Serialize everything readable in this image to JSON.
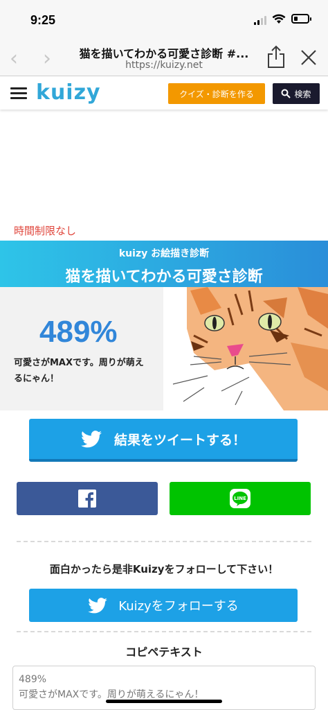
{
  "status_bar": {
    "time": "9:25",
    "battery_level": 0.25
  },
  "browser": {
    "back_icon": "chevron-left-icon",
    "forward_icon": "chevron-right-icon",
    "page_title": "猫を描いてわかる可愛さ診断 #...",
    "url": "https://kuizy.net",
    "share_icon": "share-icon",
    "close_icon": "close-icon"
  },
  "header": {
    "logo": "kuizy",
    "create_label": "クイズ・診断を作る",
    "search_label": "検索",
    "colors": {
      "logo": "#31a7d8",
      "create": "#f39800",
      "search": "#1a1a2e"
    }
  },
  "main": {
    "time_limit": "時間制限なし",
    "banner": {
      "subtitle": "kuizy お絵描き診断",
      "title": "猫を描いてわかる可愛さ診断"
    },
    "result": {
      "percent": "489%",
      "text": "可愛さがMAXです。周りが萌えるにゃん！"
    },
    "tweet_label": "結果をツイートする！",
    "facebook_icon": "facebook-icon",
    "line_icon": "line-icon",
    "follow_heading": "面白かったら是非Kuizyをフォローして下さい！",
    "follow_label": "Kuizyをフォローする",
    "copy_heading": "コピペテキスト",
    "copy_text_line1": "489%",
    "copy_text_line2": "可愛さがMAXです。周りが萌えるにゃん！",
    "colors": {
      "twitter": "#1da1e6",
      "facebook": "#3b5998",
      "line": "#00c300",
      "percent": "#3186d9"
    }
  }
}
